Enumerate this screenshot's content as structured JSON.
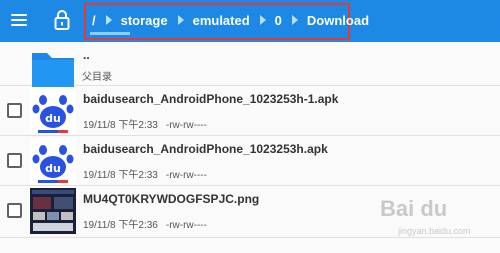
{
  "toolbar": {
    "breadcrumb": [
      "/",
      "storage",
      "emulated",
      "0",
      "Download"
    ]
  },
  "parent_row": {
    "name": "..",
    "subtitle": "父目录"
  },
  "files": [
    {
      "name": "baidusearch_AndroidPhone_1023253h-1.apk",
      "date": "19/11/8 下午2:33",
      "perms": "-rw-rw----",
      "thumb": "baidu-app-icon"
    },
    {
      "name": "baidusearch_AndroidPhone_1023253h.apk",
      "date": "19/11/8 下午2:33",
      "perms": "-rw-rw----",
      "thumb": "baidu-app-icon"
    },
    {
      "name": "MU4QT0KRYWDOGFSPJC.png",
      "date": "19/11/8 下午2:36",
      "perms": "-rw-rw----",
      "thumb": "screenshot-thumbnail"
    }
  ],
  "watermark": {
    "logo": "Bai du",
    "url": "jingyan.baidu.com"
  },
  "colors": {
    "toolbar": "#1e88e5",
    "highlight_box": "#e53935",
    "folder": "#1e88e5",
    "baidu_blue": "#2952e3",
    "baidu_red": "#e53935"
  }
}
